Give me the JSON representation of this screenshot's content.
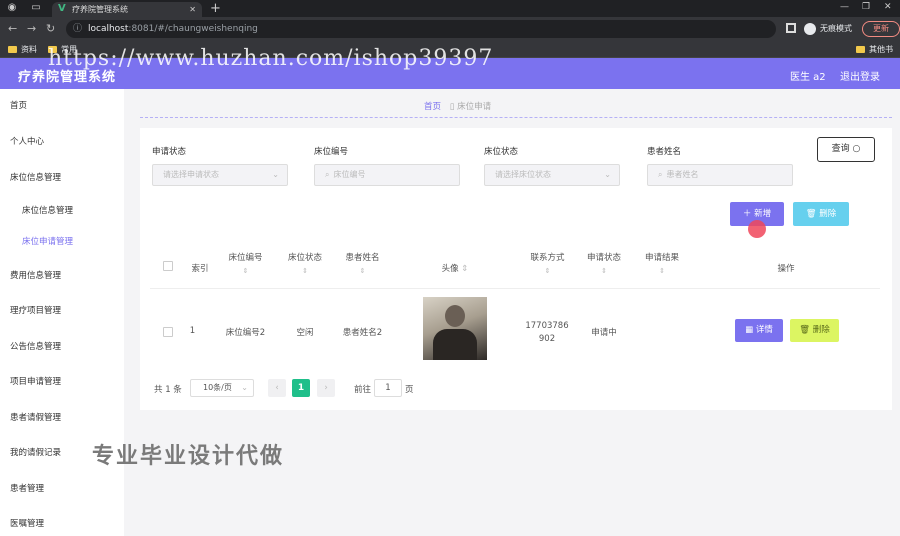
{
  "browser": {
    "tab_title": "疗养院管理系统",
    "url_host": "localhost",
    "url_rest": ":8081/#/chaungweishenqing",
    "profile_label": "无痕模式",
    "update_label": "更新",
    "bookmarks": [
      "资料",
      "常用",
      "其他书签"
    ]
  },
  "watermark": "https://www.huzhan.com/ishop39397",
  "header": {
    "title": "疗养院管理系统",
    "user": "医生 a2",
    "logout": "退出登录"
  },
  "sidebar": {
    "items": [
      {
        "label": "首页"
      },
      {
        "label": "个人中心"
      },
      {
        "label": "床位信息管理"
      },
      {
        "label": "床位信息管理"
      },
      {
        "label": "床位申请管理"
      },
      {
        "label": "费用信息管理"
      },
      {
        "label": "理疗项目管理"
      },
      {
        "label": "公告信息管理"
      },
      {
        "label": "项目申请管理"
      },
      {
        "label": "患者请假管理"
      },
      {
        "label": "我的请假记录"
      },
      {
        "label": "患者管理"
      },
      {
        "label": "医嘱管理"
      }
    ]
  },
  "breadcrumb": {
    "home": "首页",
    "current": "床位申请"
  },
  "filters": {
    "status_label": "申请状态",
    "status_placeholder": "请选择申请状态",
    "bed_no_label": "床位编号",
    "bed_no_placeholder": "床位编号",
    "bed_status_label": "床位状态",
    "bed_status_placeholder": "请选择床位状态",
    "patient_label": "患者姓名",
    "patient_placeholder": "患者姓名",
    "query_label": "查询"
  },
  "actions": {
    "add_label": "新增",
    "delete_label": "删除"
  },
  "table": {
    "headers": {
      "index": "索引",
      "bed_no": "床位编号",
      "bed_status": "床位状态",
      "patient": "患者姓名",
      "avatar": "头像",
      "phone": "联系方式",
      "apply_status": "申请状态",
      "apply_result": "申请结果",
      "ops": "操作"
    },
    "rows": [
      {
        "index": "1",
        "bed_no": "床位编号2",
        "bed_status": "空闲",
        "patient": "患者姓名2",
        "phone_line1": "17703786",
        "phone_line2": "902",
        "apply_status": "申请中",
        "apply_result": "",
        "detail_label": "详情",
        "delete_label": "删除"
      }
    ]
  },
  "pagination": {
    "total": "共 1 条",
    "page_size": "10条/页",
    "current": "1",
    "goto_label": "前往",
    "goto_value": "1",
    "page_suffix": "页"
  },
  "promo": "专业毕业设计代做"
}
